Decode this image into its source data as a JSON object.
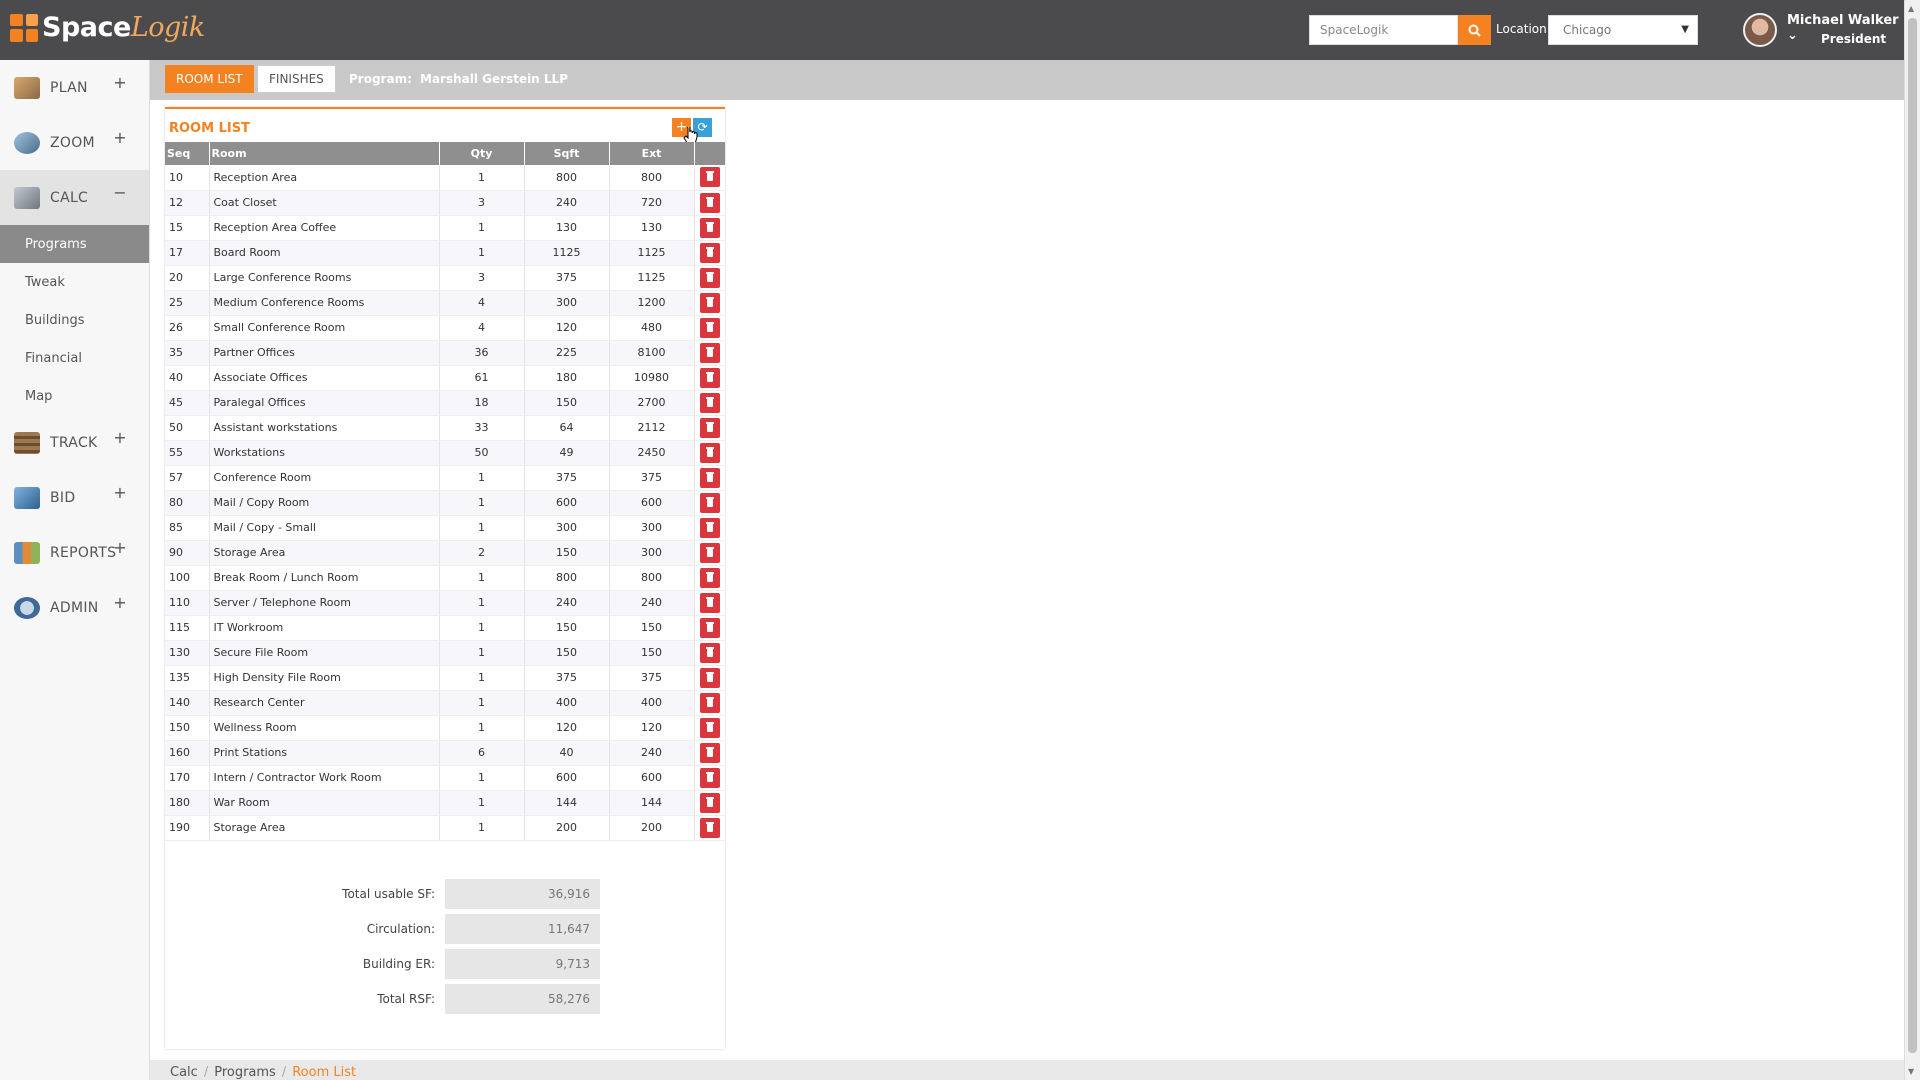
{
  "brand": {
    "name_bold": "Space",
    "name_light": "Logik"
  },
  "header": {
    "search_placeholder": "SpaceLogik",
    "location_label": "Location:",
    "location_value": "Chicago",
    "user_name": "Michael Walker",
    "user_role": "President"
  },
  "sidebar": {
    "items": [
      {
        "label": "PLAN",
        "toggle": "+"
      },
      {
        "label": "ZOOM",
        "toggle": "+"
      },
      {
        "label": "CALC",
        "toggle": "−"
      },
      {
        "label": "TRACK",
        "toggle": "+"
      },
      {
        "label": "BID",
        "toggle": "+"
      },
      {
        "label": "REPORTS",
        "toggle": "+"
      },
      {
        "label": "ADMIN",
        "toggle": "+"
      }
    ],
    "calc_sub": [
      "Programs",
      "Tweak",
      "Buildings",
      "Financial",
      "Map"
    ]
  },
  "tabs": {
    "room_list": "ROOM LIST",
    "finishes": "FINISHES",
    "program_label": "Program:",
    "program_value": "Marshall Gerstein LLP"
  },
  "panel": {
    "title": "ROOM LIST",
    "add_glyph": "+",
    "refresh_glyph": "⟳"
  },
  "table": {
    "headers": [
      "Seq",
      "Room",
      "Qty",
      "Sqft",
      "Ext"
    ],
    "rows": [
      [
        "10",
        "Reception Area",
        "1",
        "800",
        "800"
      ],
      [
        "12",
        "Coat Closet",
        "3",
        "240",
        "720"
      ],
      [
        "15",
        "Reception Area Coffee",
        "1",
        "130",
        "130"
      ],
      [
        "17",
        "Board Room",
        "1",
        "1125",
        "1125"
      ],
      [
        "20",
        "Large Conference Rooms",
        "3",
        "375",
        "1125"
      ],
      [
        "25",
        "Medium Conference Rooms",
        "4",
        "300",
        "1200"
      ],
      [
        "26",
        "Small Conference Room",
        "4",
        "120",
        "480"
      ],
      [
        "35",
        "Partner Offices",
        "36",
        "225",
        "8100"
      ],
      [
        "40",
        "Associate Offices",
        "61",
        "180",
        "10980"
      ],
      [
        "45",
        "Paralegal Offices",
        "18",
        "150",
        "2700"
      ],
      [
        "50",
        "Assistant workstations",
        "33",
        "64",
        "2112"
      ],
      [
        "55",
        "Workstations",
        "50",
        "49",
        "2450"
      ],
      [
        "57",
        "Conference Room",
        "1",
        "375",
        "375"
      ],
      [
        "80",
        "Mail / Copy Room",
        "1",
        "600",
        "600"
      ],
      [
        "85",
        "Mail / Copy - Small",
        "1",
        "300",
        "300"
      ],
      [
        "90",
        "Storage Area",
        "2",
        "150",
        "300"
      ],
      [
        "100",
        "Break Room / Lunch Room",
        "1",
        "800",
        "800"
      ],
      [
        "110",
        "Server / Telephone Room",
        "1",
        "240",
        "240"
      ],
      [
        "115",
        "IT Workroom",
        "1",
        "150",
        "150"
      ],
      [
        "130",
        "Secure File Room",
        "1",
        "150",
        "150"
      ],
      [
        "135",
        "High Density File Room",
        "1",
        "375",
        "375"
      ],
      [
        "140",
        "Research Center",
        "1",
        "400",
        "400"
      ],
      [
        "150",
        "Wellness Room",
        "1",
        "120",
        "120"
      ],
      [
        "160",
        "Print Stations",
        "6",
        "40",
        "240"
      ],
      [
        "170",
        "Intern / Contractor Work Room",
        "1",
        "600",
        "600"
      ],
      [
        "180",
        "War Room",
        "1",
        "144",
        "144"
      ],
      [
        "190",
        "Storage Area",
        "1",
        "200",
        "200"
      ]
    ]
  },
  "totals": [
    {
      "label": "Total usable SF:",
      "value": "36,916"
    },
    {
      "label": "Circulation:",
      "value": "11,647"
    },
    {
      "label": "Building ER:",
      "value": "9,713"
    },
    {
      "label": "Total RSF:",
      "value": "58,276"
    }
  ],
  "breadcrumb": [
    "Calc",
    "Programs",
    "Room List"
  ],
  "colors": {
    "accent": "#f58220",
    "header_bg": "#4b4b4d",
    "delete": "#d9363e",
    "refresh": "#3aa0d8"
  }
}
